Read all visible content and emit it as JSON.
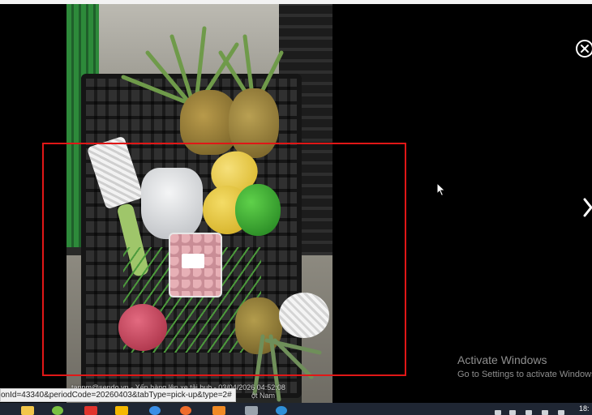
{
  "viewer": {
    "photo_caption": "tanpm@sendo.vn - Xếp hàng lên xe tải hub - 03/04/2026 04:52:08",
    "photo_caption_line2": "ột Nam"
  },
  "browser": {
    "status_url": "onId=43340&periodCode=20260403&tabType=pick-up&type=2#"
  },
  "watermark": {
    "title": "Activate Windows",
    "subtitle": "Go to Settings to activate Windows."
  },
  "taskbar": {
    "clock": "18:"
  },
  "colors": {
    "annotation_frame": "#e01717",
    "background": "#000000",
    "taskbar": "#1f2633"
  },
  "icons": {
    "close": "close-circle-icon",
    "next": "chevron-right-icon",
    "cursor": "mouse-pointer-icon"
  }
}
